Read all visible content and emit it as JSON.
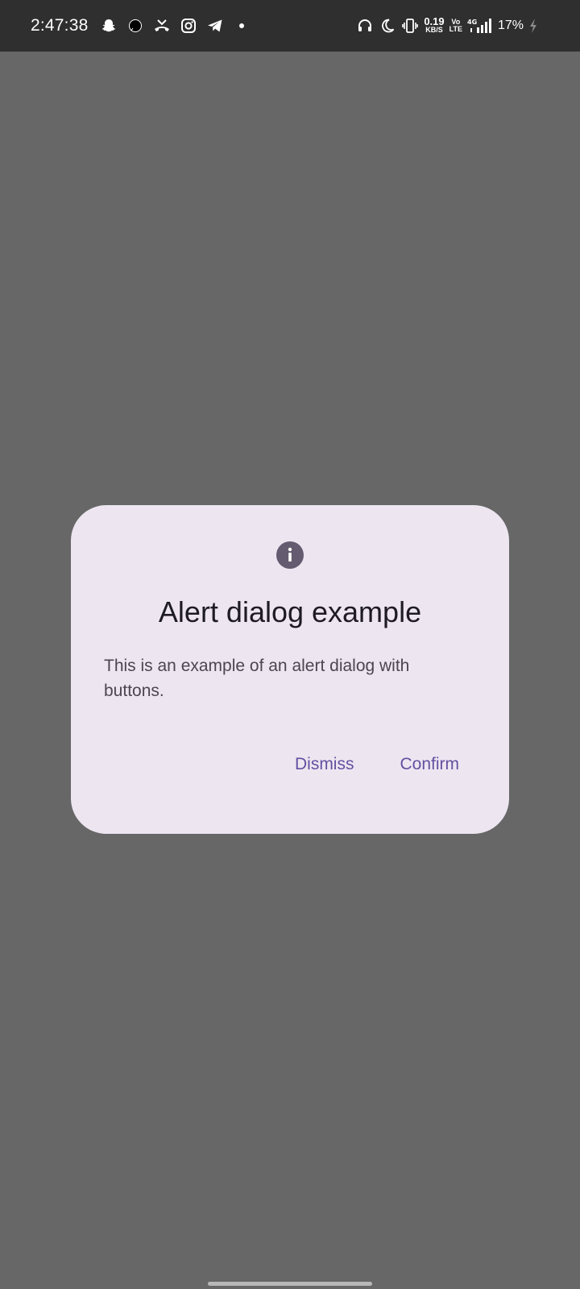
{
  "status_bar": {
    "time": "2:47:38",
    "left_icons": [
      "snapchat-icon",
      "chat-bubble-icon",
      "missed-call-icon",
      "instagram-icon",
      "telegram-icon",
      "dot-icon"
    ],
    "right_icons": [
      "headphones-icon",
      "do-not-disturb-moon-icon",
      "vibrate-icon"
    ],
    "net_speed_value": "0.19",
    "net_speed_unit": "KB/S",
    "volte_top": "Vo",
    "volte_bottom": "LTE",
    "network": "4G",
    "battery_percent": "17%",
    "battery_icon": "charging-bolt-icon"
  },
  "dialog": {
    "icon": "info-icon",
    "title": "Alert dialog example",
    "text": "This is an example of an alert dialog with buttons.",
    "dismiss_label": "Dismiss",
    "confirm_label": "Confirm"
  },
  "colors": {
    "scrim": "#676767",
    "status_bar": "#2f2f2f",
    "dialog_surface": "#ede6f1",
    "accent": "#654fa0",
    "title": "#1f1b24",
    "body": "#4b4650",
    "icon": "#645b70"
  }
}
